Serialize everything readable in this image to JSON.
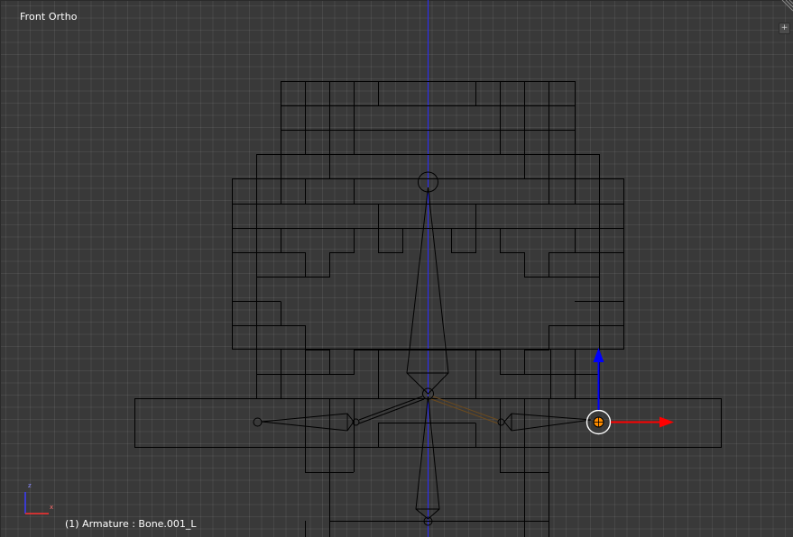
{
  "viewport": {
    "view_label": "Front Ortho",
    "object_info": "(1) Armature : Bone.001_L",
    "toolshelf_toggle": "+"
  },
  "gizmo": {
    "axis_z_label": "z",
    "axis_x_label": "x"
  },
  "colors": {
    "background": "#393939",
    "grid": "#454545",
    "wire": "#000000",
    "axis_z": "#0000ff",
    "axis_x": "#ff0000",
    "active_bone": "#ff8c00",
    "selection": "#ffffff"
  },
  "icons": {
    "corner_widget": "split-corner-icon",
    "toolshelf": "plus-icon",
    "manipulator": "translate-manipulator-icon"
  }
}
